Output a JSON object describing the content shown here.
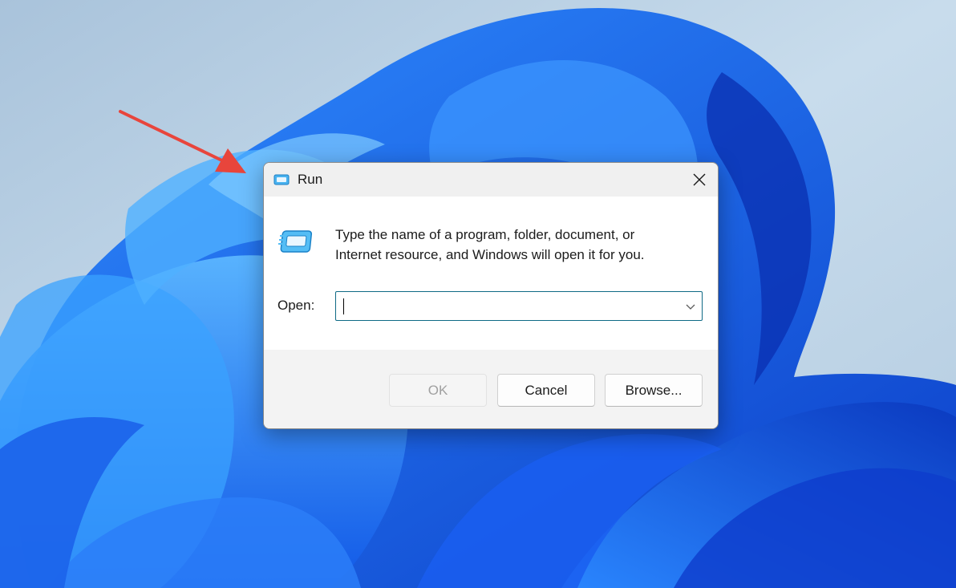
{
  "dialog": {
    "title": "Run",
    "description_line1": "Type the name of a program, folder, document, or",
    "description_line2": "Internet resource, and Windows will open it for you.",
    "open_label": "Open:",
    "open_value": "",
    "buttons": {
      "ok": "OK",
      "cancel": "Cancel",
      "browse": "Browse..."
    }
  },
  "icons": {
    "title": "run-app-icon",
    "main": "run-app-icon",
    "close": "close-icon",
    "dropdown": "chevron-down-icon"
  },
  "colors": {
    "accent": "#0f6a85",
    "annotation_arrow": "#e8453c",
    "wallpaper_blue": "#1e6ff0"
  }
}
